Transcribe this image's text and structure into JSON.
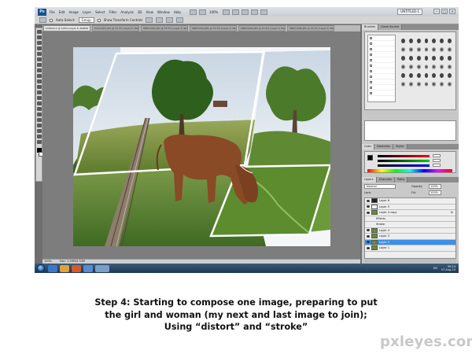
{
  "app": {
    "logo": "Ps",
    "menu": [
      "File",
      "Edit",
      "Image",
      "Layer",
      "Select",
      "Filter",
      "Analysis",
      "3D",
      "View",
      "Window",
      "Help"
    ],
    "zoom": "100%",
    "workspace": "UNTITLED-1",
    "window_buttons": [
      "–",
      "□",
      "×"
    ]
  },
  "options_bar": {
    "auto_select_label": "Auto-Select:",
    "auto_select_value": "Group",
    "transform_label": "Show Transform Controls"
  },
  "doc_tabs": [
    {
      "label": "Untitled-1 @ 100% (Layer 6, RGB/8)",
      "active": true
    },
    {
      "label": "P1011001.JPG @ 33.3% (Layer 0, RGB/8)",
      "active": false
    },
    {
      "label": "OB8T1003.JPG @ 33.3% (Layer 0, RGB/8)",
      "active": false
    },
    {
      "label": "OB8T1004.JPG @ 33.3% (Layer 0, RGB/8)",
      "active": false
    },
    {
      "label": "OB8T1005.JPG @ 33.3% (Layer 0, RGB/8)",
      "active": false
    },
    {
      "label": "OB8T1006.JPG @ 33.3% (Layer 0, RGB/8)",
      "active": false
    }
  ],
  "status_bar": {
    "zoom": "100%",
    "doc_size": "Doc: 1.26M/4.34M"
  },
  "panels": {
    "brushes_tabs": [
      "Brushes",
      "Clone Source"
    ],
    "color_tabs": [
      "Color",
      "Swatches",
      "Styles"
    ],
    "color_values": {
      "r": "0",
      "g": "0",
      "b": "0"
    },
    "layers_tabs": [
      "Layers",
      "Channels",
      "Paths"
    ],
    "blend_mode": "Normal",
    "opacity_label": "Opacity:",
    "opacity_value": "100%",
    "lock_label": "Lock:",
    "fill_label": "Fill:",
    "fill_value": "100%"
  },
  "layers": [
    {
      "name": "Layer 6",
      "thumb": "dark",
      "selected": false,
      "fx": false
    },
    {
      "name": "Layer 5",
      "thumb": "white",
      "selected": false,
      "fx": false
    },
    {
      "name": "Layer 4 copy",
      "thumb": "green",
      "selected": false,
      "fx": true
    },
    {
      "name": "Effects",
      "thumb": "none",
      "selected": false,
      "fx": false,
      "sub": true
    },
    {
      "name": "Stroke",
      "thumb": "none",
      "selected": false,
      "fx": false,
      "sub": true
    },
    {
      "name": "Layer 4",
      "thumb": "green",
      "selected": false,
      "fx": false
    },
    {
      "name": "Layer 3",
      "thumb": "green",
      "selected": false,
      "fx": false
    },
    {
      "name": "Layer 2",
      "thumb": "green",
      "selected": true,
      "fx": false
    },
    {
      "name": "Layer 1",
      "thumb": "green",
      "selected": false,
      "fx": false
    }
  ],
  "taskbar": {
    "time": "09:14",
    "date": "07-Aug-10",
    "lang": "EN"
  },
  "caption": {
    "line1": "Step 4: Starting to compose one image, preparing to put",
    "line2": "the girl and woman (my next and last image to join);",
    "line3": "Using “distort” and “stroke”"
  },
  "watermark": "pxleyes.com",
  "colors": {
    "selection": "#3d8ee8",
    "taskbar": "#1e3752",
    "canvas_bg": "#7d7d7d"
  }
}
